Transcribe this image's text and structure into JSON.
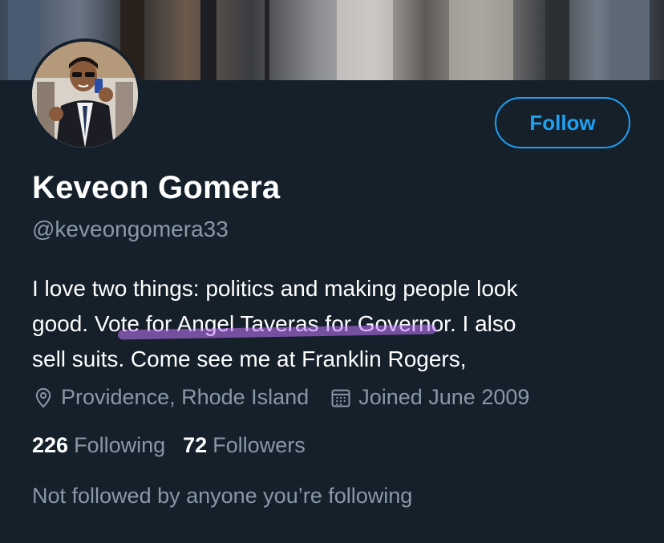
{
  "profile": {
    "name": "Keveon Gomera",
    "handle": "@keveongomera33",
    "follow_label": "Follow",
    "bio": {
      "line1": "I love two things: politics and making people look",
      "line2_start": "good. Vo",
      "line2_highlight": "te for Angel Taveras for Govern",
      "line2_end": "or. I also",
      "line3": "sell suits. Come see me at Franklin Rogers,"
    },
    "location": "Providence, Rhode Island",
    "joined": "Joined June 2009",
    "following_count": "226",
    "following_label": "Following",
    "followers_count": "72",
    "followers_label": "Followers",
    "mutual_notice": "Not followed by anyone you’re following"
  },
  "icons": {
    "location": "location-pin-icon",
    "calendar": "calendar-icon"
  },
  "colors": {
    "background": "#15202b",
    "accent": "#1da1f2",
    "secondary_text": "#8899a6",
    "highlight": "#c478ff"
  }
}
